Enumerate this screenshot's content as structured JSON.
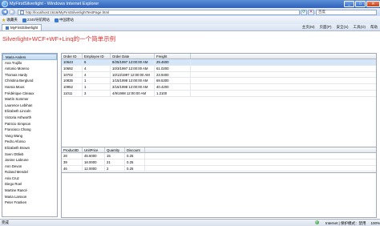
{
  "window": {
    "title": "MyFirstSilverlight - Windows Internet Explorer",
    "buttons": [
      "_",
      "□",
      "✕"
    ]
  },
  "nav": {
    "address": "http://localhost:1616/MyFirstSilverlightTestPage.html",
    "search_placeholder": "百度"
  },
  "favorites": {
    "label": "收藏夹",
    "items": [
      "2345导航网站",
      "中国建站"
    ]
  },
  "tab": {
    "label": "MyFirstSilverlight",
    "tools": [
      "主页(M)",
      "页面(P)",
      "安全(S)",
      "工具(O)",
      "帮助"
    ]
  },
  "page": {
    "heading": "Silverlight+WCF+WF+Linq的一个简单示例"
  },
  "customers": [
    "Maria Anders",
    "Ana Trujillo",
    "Antonio Moreno",
    "Thomas Hardy",
    "Christina Berglund",
    "Hanna Moos",
    "Frédérique Citeaux",
    "Martín Sommer",
    "Laurence Lebihan",
    "Elizabeth Lincoln",
    "Victoria Ashworth",
    "Patricio Simpson",
    "Francisco Chang",
    "Yang Wang",
    "Pedro Afonso",
    "Elizabeth Brown",
    "Sven Ottlieb",
    "Janine Labrune",
    "Ann Devon",
    "Roland Mendel",
    "Aria Cruz",
    "Diego Roel",
    "Martine Rancé",
    "Maria Larsson",
    "Peter Franken"
  ],
  "orders": {
    "columns": [
      "Order ID",
      "Employee ID",
      "Order Date",
      "Freight"
    ],
    "rows": [
      [
        "10643",
        "6",
        "8/25/1997 12:00:00 AM",
        "29.4600"
      ],
      [
        "10692",
        "4",
        "10/3/1997 12:00:00 AM",
        "61.0200"
      ],
      [
        "10702",
        "4",
        "10/13/1997 12:00:00 AM",
        "23.9400"
      ],
      [
        "10835",
        "1",
        "1/15/1998 12:00:00 AM",
        "69.5300"
      ],
      [
        "10952",
        "1",
        "3/16/1998 12:00:00 AM",
        "40.4200"
      ],
      [
        "11011",
        "3",
        "4/9/1998 12:00:00 AM",
        "1.2100"
      ]
    ]
  },
  "details": {
    "columns": [
      "ProductID",
      "UnitPrice",
      "Quantity",
      "Discount"
    ],
    "rows": [
      [
        "28",
        "45.6000",
        "15",
        "0.25"
      ],
      [
        "39",
        "18.0000",
        "21",
        "0.25"
      ],
      [
        "46",
        "12.0000",
        "2",
        "0.25"
      ]
    ]
  },
  "status": {
    "left": "完成",
    "zone": "Internet | 保护模式：禁用",
    "zoom": "100%"
  }
}
